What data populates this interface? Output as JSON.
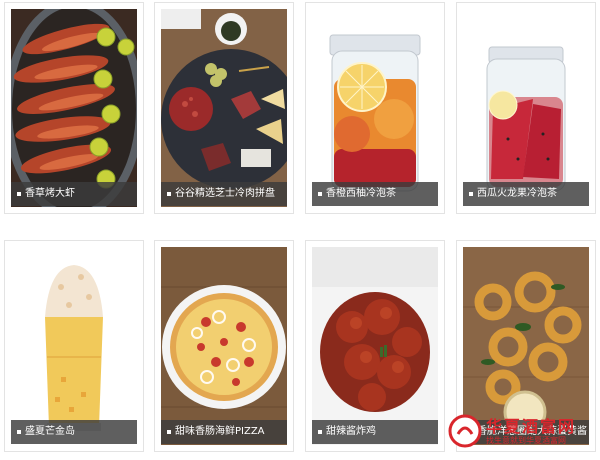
{
  "items": [
    {
      "caption": "香草烤大虾",
      "photo": "grilled-shrimp-image"
    },
    {
      "caption": "谷谷精选芝士冷肉拼盘",
      "photo": "cheese-cold-meat-platter-image"
    },
    {
      "caption": "香橙西柚冷泡茶",
      "photo": "orange-grapefruit-cold-tea-image"
    },
    {
      "caption": "西瓜火龙果冷泡茶",
      "photo": "watermelon-dragonfruit-cold-tea-image"
    },
    {
      "caption": "盛夏芒金岛",
      "photo": "mango-drink-image"
    },
    {
      "caption": "甜味香肠海鲜PIZZA",
      "photo": "sausage-seafood-pizza-image"
    },
    {
      "caption": "甜辣酱炸鸡",
      "photo": "sweet-spicy-fried-chicken-image"
    },
    {
      "caption": "香脆洋葱圈配大蒜蛋黄酱",
      "photo": "onion-rings-image"
    }
  ],
  "watermark": {
    "brand": "华夏酒富网",
    "sub": "找生意就到华夏酒富网"
  }
}
